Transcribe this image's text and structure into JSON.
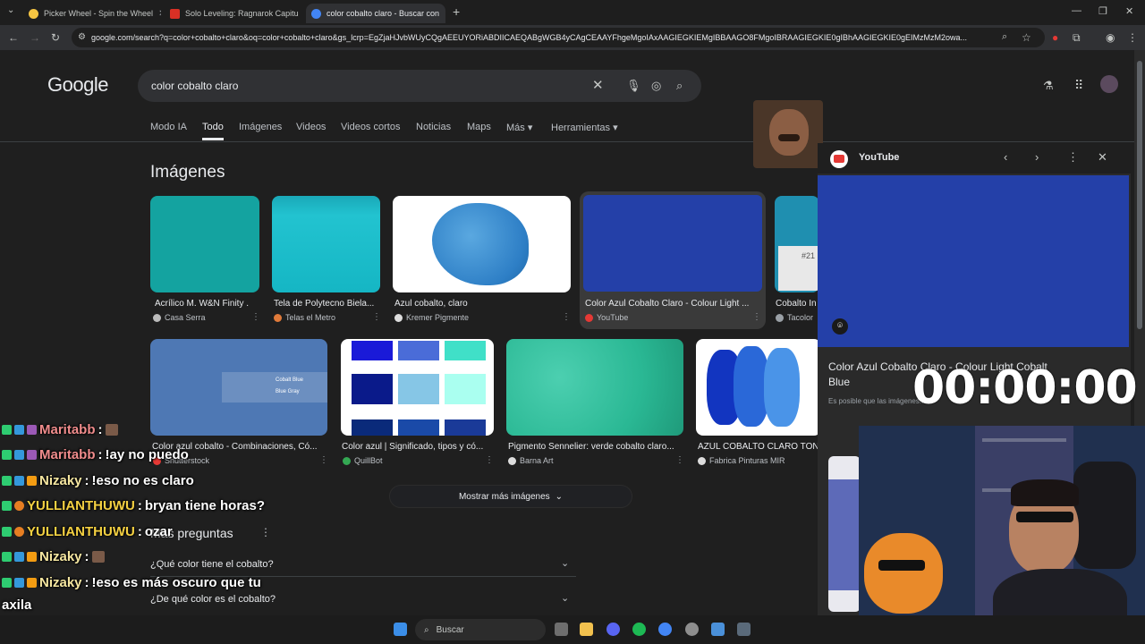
{
  "tabs": [
    {
      "title": "Picker Wheel - Spin the Wheel",
      "icon": "picker-wheel-favicon",
      "color": "#f5c542"
    },
    {
      "title": "Solo Leveling: Ragnarok Capitu",
      "icon": "mw-favicon",
      "color": "#d93025"
    },
    {
      "title": "color cobalto claro - Buscar con",
      "icon": "google-favicon",
      "color": "#4285f4"
    }
  ],
  "new_tab_label": "+",
  "window_controls": [
    "—",
    "❐",
    "✕"
  ],
  "url": "google.com/search?q=color+cobalto+claro&oq=color+cobalto+claro&gs_lcrp=EgZjaHJvbWUyCQgAEEUYORiABDIICAEQABgWGB4yCAgCEAAYFhgeMgoIAxAAGIEGKIEMgIBBAAGO8FMgoIBRAAGIEGKIE0gIBhAAGIEGKIE0gEIMzMzM2owa...",
  "google": {
    "logo": "Google",
    "query": "color cobalto claro",
    "nav_tabs": [
      "Modo IA",
      "Todo",
      "Imágenes",
      "Videos",
      "Videos cortos",
      "Noticias",
      "Maps",
      "Más ▾",
      "Herramientas ▾"
    ],
    "images_heading": "Imágenes",
    "row1": [
      {
        "caption": "Acrílico M. W&N Finity ...",
        "source": "Casa Serra"
      },
      {
        "caption": "Tela de Polytecno Biela...",
        "source": "Telas el Metro"
      },
      {
        "caption": "Azul cobalto, claro",
        "source": "Kremer Pigmente"
      },
      {
        "caption": "Color Azul Cobalto Claro - Colour Light ...",
        "source": "YouTube"
      },
      {
        "caption": "Cobalto In",
        "source": "Tacolor"
      }
    ],
    "row2": [
      {
        "caption": "Color azul cobalto - Combinaciones, Có...",
        "source": "Shutterstock"
      },
      {
        "caption": "Color azul | Significado, tipos y có...",
        "source": "QuillBot"
      },
      {
        "caption": "Pigmento Sennelier: verde cobalto claro...",
        "source": "Barna Art"
      },
      {
        "caption": "AZUL COBALTO CLARO TON",
        "source": "Fabrica Pinturas MIR"
      }
    ],
    "thumb_texts": {
      "cobalt_blue": "Cobalt Blue",
      "blue_gray": "Blue Gray",
      "swatch_code": "#21"
    },
    "show_more": "Mostrar más imágenes",
    "paa_heading": "Más preguntas",
    "paa": [
      "¿Qué color tiene el cobalto?",
      "¿De qué color es el cobalto?"
    ]
  },
  "youtube_panel": {
    "header": "YouTube",
    "title": "Color Azul Cobalto Claro - Colour Light Cobalt Blue",
    "description": "Es posible que las imágenes..."
  },
  "timer": "00:00:00",
  "chat": [
    {
      "user": "Maritabb",
      "color": "#f08c8c",
      "message": "",
      "emote": true
    },
    {
      "user": "Maritabb",
      "color": "#f08c8c",
      "message": "!ay no puedo",
      "emote": false
    },
    {
      "user": "Nizaky",
      "color": "#f5e6a0",
      "message": "!eso no es claro",
      "emote": false
    },
    {
      "user": "YULLIANTHUWU",
      "color": "#f5d142",
      "message": "bryan tiene horas?",
      "emote": false
    },
    {
      "user": "YULLIANTHUWU",
      "color": "#f5d142",
      "message": "ozar",
      "emote": false
    },
    {
      "user": "Nizaky",
      "color": "#f5e6a0",
      "message": "",
      "emote": true
    },
    {
      "user": "Nizaky",
      "color": "#f5e6a0",
      "message": "!eso es más oscuro que tu",
      "emote": false
    },
    {
      "user": "",
      "color": "#ffffff",
      "message": "axila",
      "emote": false
    },
    {
      "user": "Nizaky",
      "color": "#f5e6a0",
      "message": "",
      "emote": true
    }
  ],
  "taskbar": {
    "search_placeholder": "Buscar"
  },
  "colors": {
    "accent": "#8ab4f8",
    "bg": "#1f1f1f",
    "cobalt": "#2440a8"
  }
}
